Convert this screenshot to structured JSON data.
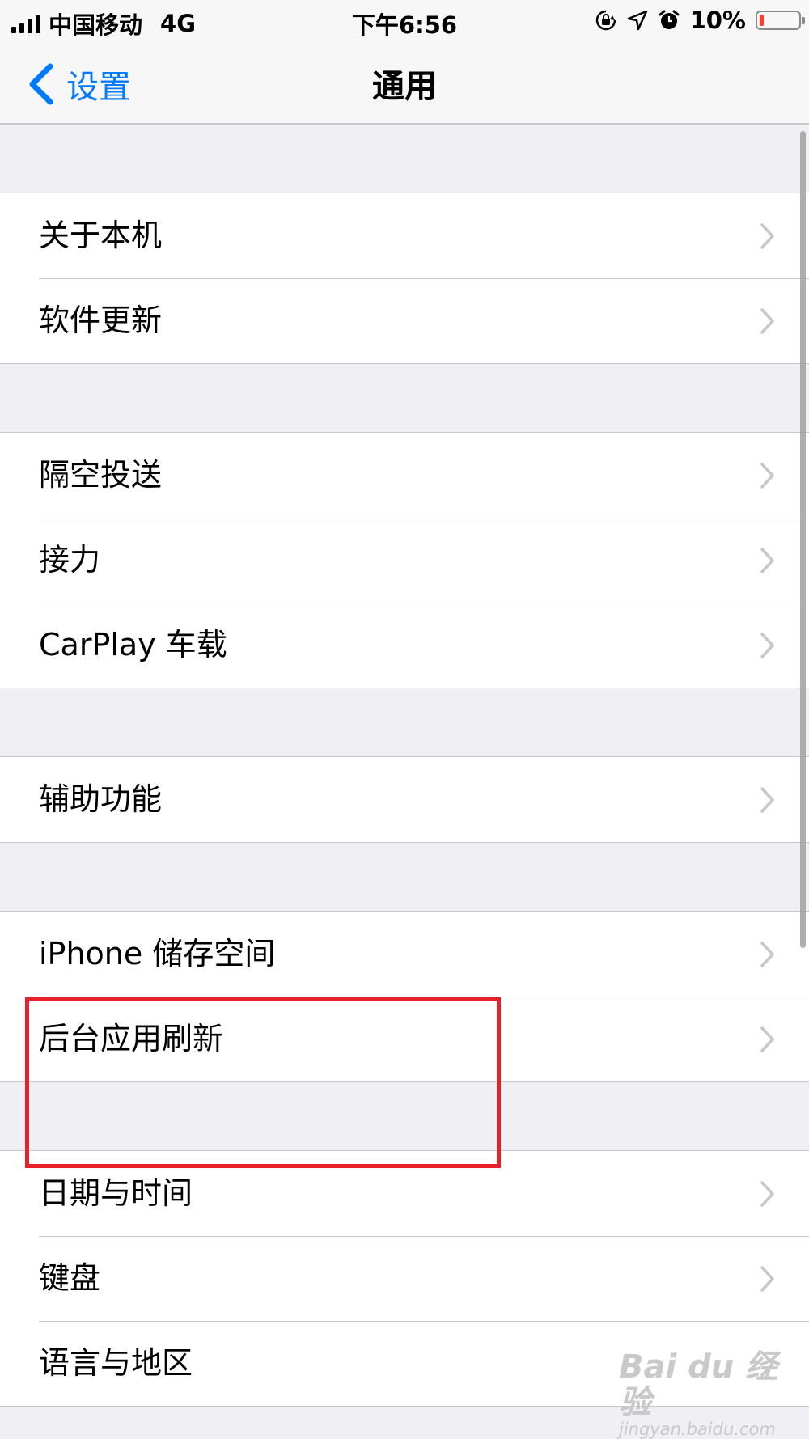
{
  "status_bar": {
    "carrier": "中国移动",
    "network": "4G",
    "time": "下午6:56",
    "battery_percent": "10%",
    "battery_level": 0.1,
    "icons": [
      "orientation-lock-icon",
      "location-icon",
      "alarm-icon",
      "battery-icon"
    ]
  },
  "nav": {
    "back_label": "设置",
    "title": "通用"
  },
  "groups": [
    {
      "items": [
        {
          "label": "关于本机"
        },
        {
          "label": "软件更新"
        }
      ]
    },
    {
      "items": [
        {
          "label": "隔空投送"
        },
        {
          "label": "接力"
        },
        {
          "label": "CarPlay 车载"
        }
      ]
    },
    {
      "items": [
        {
          "label": "辅助功能"
        }
      ]
    },
    {
      "items": [
        {
          "label": "iPhone 储存空间"
        },
        {
          "label": "后台应用刷新"
        }
      ]
    },
    {
      "items": [
        {
          "label": "日期与时间"
        },
        {
          "label": "键盘"
        },
        {
          "label": "语言与地区"
        }
      ]
    }
  ],
  "watermark": {
    "main": "Bai du 经验",
    "sub": "jingyan.baidu.com"
  },
  "colors": {
    "accent": "#007aff",
    "highlight": "#e8202a",
    "background": "#efeff4",
    "battery_low": "#ff3b30"
  }
}
